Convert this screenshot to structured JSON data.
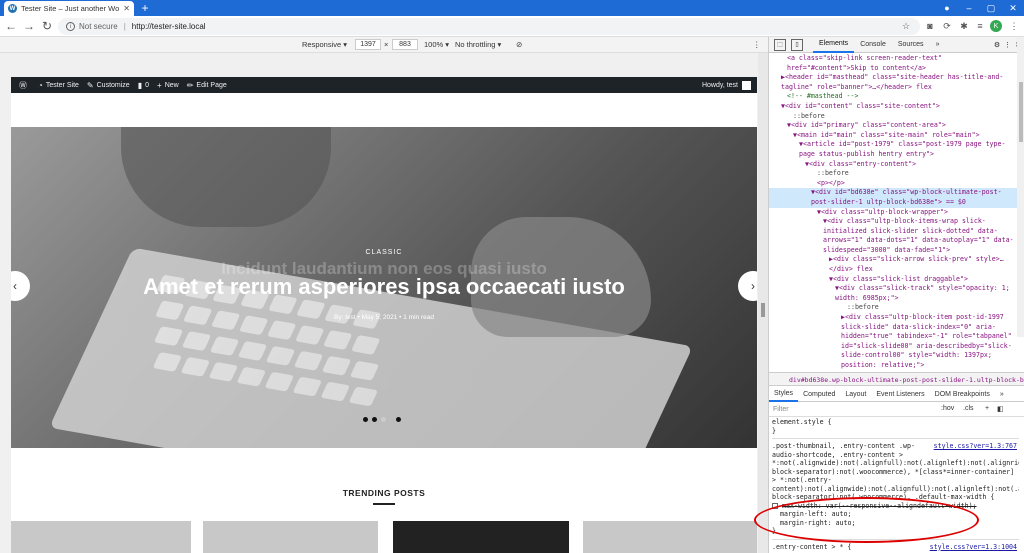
{
  "browser": {
    "tab_title": "Tester Site – Just another WordPress site",
    "new_tab": "+",
    "window_controls": [
      "–",
      "▢",
      "✕"
    ],
    "not_secure": "Not secure",
    "url": "http://tester-site.local",
    "avatar_letter": "K"
  },
  "device_toolbar": {
    "device": "Responsive ▾",
    "width": "1397",
    "times": "×",
    "height": "883",
    "zoom": "100% ▾",
    "throttle": "No throttling ▾"
  },
  "adminbar": {
    "site_name": "Tester Site",
    "customize": "Customize",
    "comments": "0",
    "new": "New",
    "edit_page": "Edit Page",
    "howdy": "Howdy, test"
  },
  "hero": {
    "ghost_text": "Incidunt laudantium non eos quasi iusto",
    "category": "CLASSIC",
    "title": "Amet et rerum asperiores ipsa occaecati iusto",
    "meta": "By: test   •   May 5, 2021   •   1 min read",
    "prev": "‹",
    "next": "›"
  },
  "trending": {
    "heading": "TRENDING POSTS"
  },
  "devtools": {
    "tabs": [
      "Elements",
      "Console",
      "Sources",
      "»"
    ],
    "dom_lines": [
      {
        "t": "<a class=\"skip-link screen-reader-text\" href=\"#content\">Skip to content</a>",
        "i": 3,
        "k": "tag"
      },
      {
        "t": "▶<header id=\"masthead\" class=\"site-header has-title-and-tagline\" role=\"banner\">…</header> flex",
        "i": 2,
        "k": "tag"
      },
      {
        "t": "<!-- #masthead -->",
        "i": 3,
        "k": "cm"
      },
      {
        "t": "▼<div id=\"content\" class=\"site-content\">",
        "i": 2,
        "k": "tag"
      },
      {
        "t": "::before",
        "i": 4,
        "k": "pl"
      },
      {
        "t": "▼<div id=\"primary\" class=\"content-area\">",
        "i": 3,
        "k": "tag"
      },
      {
        "t": "▼<main id=\"main\" class=\"site-main\" role=\"main\">",
        "i": 4,
        "k": "tag"
      },
      {
        "t": "▼<article id=\"post-1979\" class=\"post-1979 page type-page status-publish hentry entry\">",
        "i": 5,
        "k": "tag"
      },
      {
        "t": "▼<div class=\"entry-content\">",
        "i": 6,
        "k": "tag"
      },
      {
        "t": "::before",
        "i": 8,
        "k": "pl"
      },
      {
        "t": "<p></p>",
        "i": 8,
        "k": "tag"
      },
      {
        "t": "▼<div id=\"bd638e\" class=\"wp-block-ultimate-post-post-slider-1 ultp-block-bd638e\"> == $0",
        "i": 7,
        "k": "sel"
      },
      {
        "t": "▼<div class=\"ultp-block-wrapper\">",
        "i": 8,
        "k": "tag"
      },
      {
        "t": "▼<div class=\"ultp-block-items-wrap slick-initialized slick-slider slick-dotted\" data-arrows=\"1\" data-dots=\"1\" data-autoplay=\"1\" data-slidespeed=\"3000\" data-fade=\"1\">",
        "i": 9,
        "k": "tag"
      },
      {
        "t": "▶<div class=\"slick-arrow slick-prev\" style>…</div> flex",
        "i": 10,
        "k": "tag"
      },
      {
        "t": "▼<div class=\"slick-list draggable\">",
        "i": 10,
        "k": "tag"
      },
      {
        "t": "▼<div class=\"slick-track\" style=\"opacity: 1; width: 6985px;\">",
        "i": 11,
        "k": "tag"
      },
      {
        "t": "::before",
        "i": 13,
        "k": "pl"
      },
      {
        "t": "▶<div class=\"ultp-block-item post-id-1997 slick-slide\" data-slick-index=\"0\" aria-hidden=\"true\" tabindex=\"-1\" role=\"tabpanel\" id=\"slick-slide00\" aria-describedby=\"slick-slide-control00\" style=\"width: 1397px; position: relative;\">",
        "i": 12,
        "k": "tag"
      }
    ],
    "breadcrumb": "div#bd638e.wp-block-ultimate-post-post-slider-1.ultp-block-bd638e",
    "style_tabs": [
      "Styles",
      "Computed",
      "Layout",
      "Event Listeners",
      "DOM Breakpoints",
      "»"
    ],
    "filter_placeholder": "Filter",
    "filter_hov": ":hov",
    "filter_cls": ".cls",
    "element_style": "element.style {",
    "rule1_source": "style.css?ver=1.3:767",
    "rule1_selector": ".post-thumbnail, .entry-content .wp-audio-shortcode, .entry-content > *:not(.alignwide):not(.alignfull):not(.alignleft):not(.alignright):not(.wp-block-separator):not(.woocommerce), *[class*=inner-container] > *:not(.entry-content):not(.alignwide):not(.alignfull):not(.alignleft):not(.alignright):not(.wp-block-separator):not(.woocommerce), .default-max-width {",
    "prop1": "max-width: var(--responsive--aligndefault-width);",
    "prop2": "margin-left: auto;",
    "prop3": "margin-right: auto;",
    "rule2_source": "style.css?ver=1.3:1004",
    "rule2_selector": ".entry-content > * {"
  }
}
